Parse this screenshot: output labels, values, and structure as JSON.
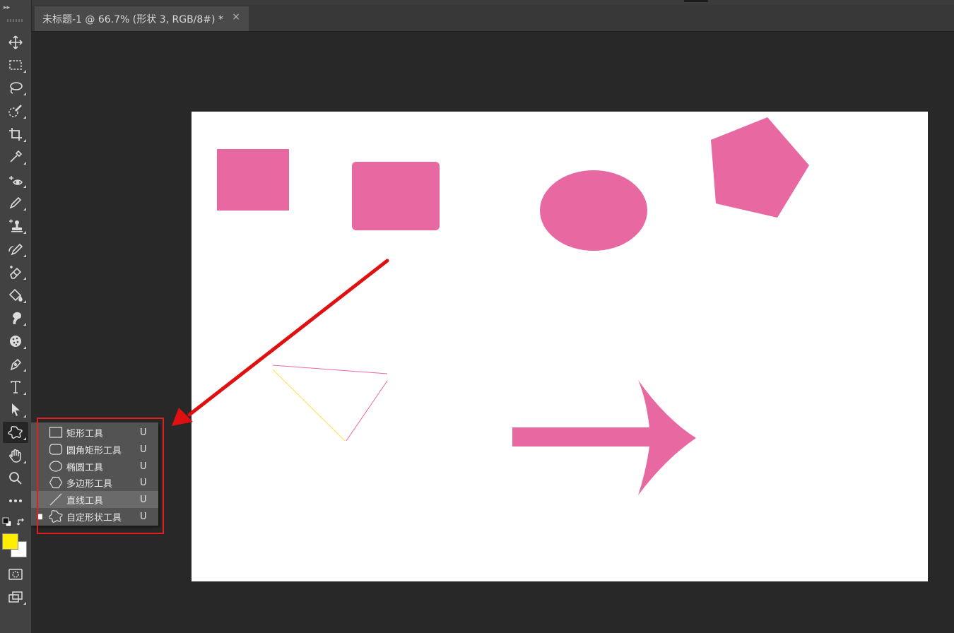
{
  "document_tab": {
    "title": "未标题-1 @ 66.7% (形状 3, RGB/8#) *",
    "close_symbol": "×"
  },
  "toolbar": {
    "collapse_glyph": "▸▸",
    "tools": [
      {
        "name": "move-tool",
        "icon": "move-icon"
      },
      {
        "name": "marquee-tool",
        "icon": "rect-marquee-icon"
      },
      {
        "name": "lasso-tool",
        "icon": "lasso-icon"
      },
      {
        "name": "quick-select-tool",
        "icon": "quick-select-icon"
      },
      {
        "name": "crop-tool",
        "icon": "crop-icon"
      },
      {
        "name": "eyedropper-tool",
        "icon": "eyedropper-icon"
      },
      {
        "name": "red-eye-tool",
        "icon": "red-eye-icon"
      },
      {
        "name": "brush-tool",
        "icon": "brush-icon"
      },
      {
        "name": "clone-stamp-tool",
        "icon": "stamp-icon"
      },
      {
        "name": "history-brush-tool",
        "icon": "history-brush-icon"
      },
      {
        "name": "eraser-tool",
        "icon": "eraser-icon"
      },
      {
        "name": "paint-bucket-tool",
        "icon": "bucket-icon"
      },
      {
        "name": "smudge-tool",
        "icon": "smudge-icon"
      },
      {
        "name": "sponge-tool",
        "icon": "sponge-icon"
      },
      {
        "name": "pen-tool",
        "icon": "pen-icon"
      },
      {
        "name": "type-tool",
        "icon": "type-icon"
      },
      {
        "name": "path-select-tool",
        "icon": "arrow-icon"
      },
      {
        "name": "custom-shape-tool",
        "icon": "custom-shape-icon",
        "active": true
      },
      {
        "name": "hand-tool",
        "icon": "hand-icon"
      },
      {
        "name": "zoom-tool",
        "icon": "zoom-icon"
      },
      {
        "name": "more-tools",
        "icon": "ellipsis-icon"
      }
    ],
    "foreground_color": "#ffee00",
    "background_color": "#ffffff"
  },
  "shape_menu": {
    "items": [
      {
        "label": "矩形工具",
        "key": "U",
        "icon": "rectangle-icon",
        "selected": false
      },
      {
        "label": "圆角矩形工具",
        "key": "U",
        "icon": "rounded-rect-icon",
        "selected": false
      },
      {
        "label": "椭圆工具",
        "key": "U",
        "icon": "ellipse-icon",
        "selected": false
      },
      {
        "label": "多边形工具",
        "key": "U",
        "icon": "polygon-icon",
        "selected": false
      },
      {
        "label": "直线工具",
        "key": "U",
        "icon": "line-icon",
        "selected": false,
        "highlighted": true
      },
      {
        "label": "自定形状工具",
        "key": "U",
        "icon": "custom-shape-icon",
        "selected": true
      }
    ]
  },
  "canvas": {
    "shape_color": "#e868a2",
    "shapes": [
      "rectangle",
      "rounded-rectangle",
      "ellipse",
      "pentagon",
      "triangle-outline",
      "arrow"
    ]
  },
  "annotation": {
    "color": "#e01010"
  }
}
